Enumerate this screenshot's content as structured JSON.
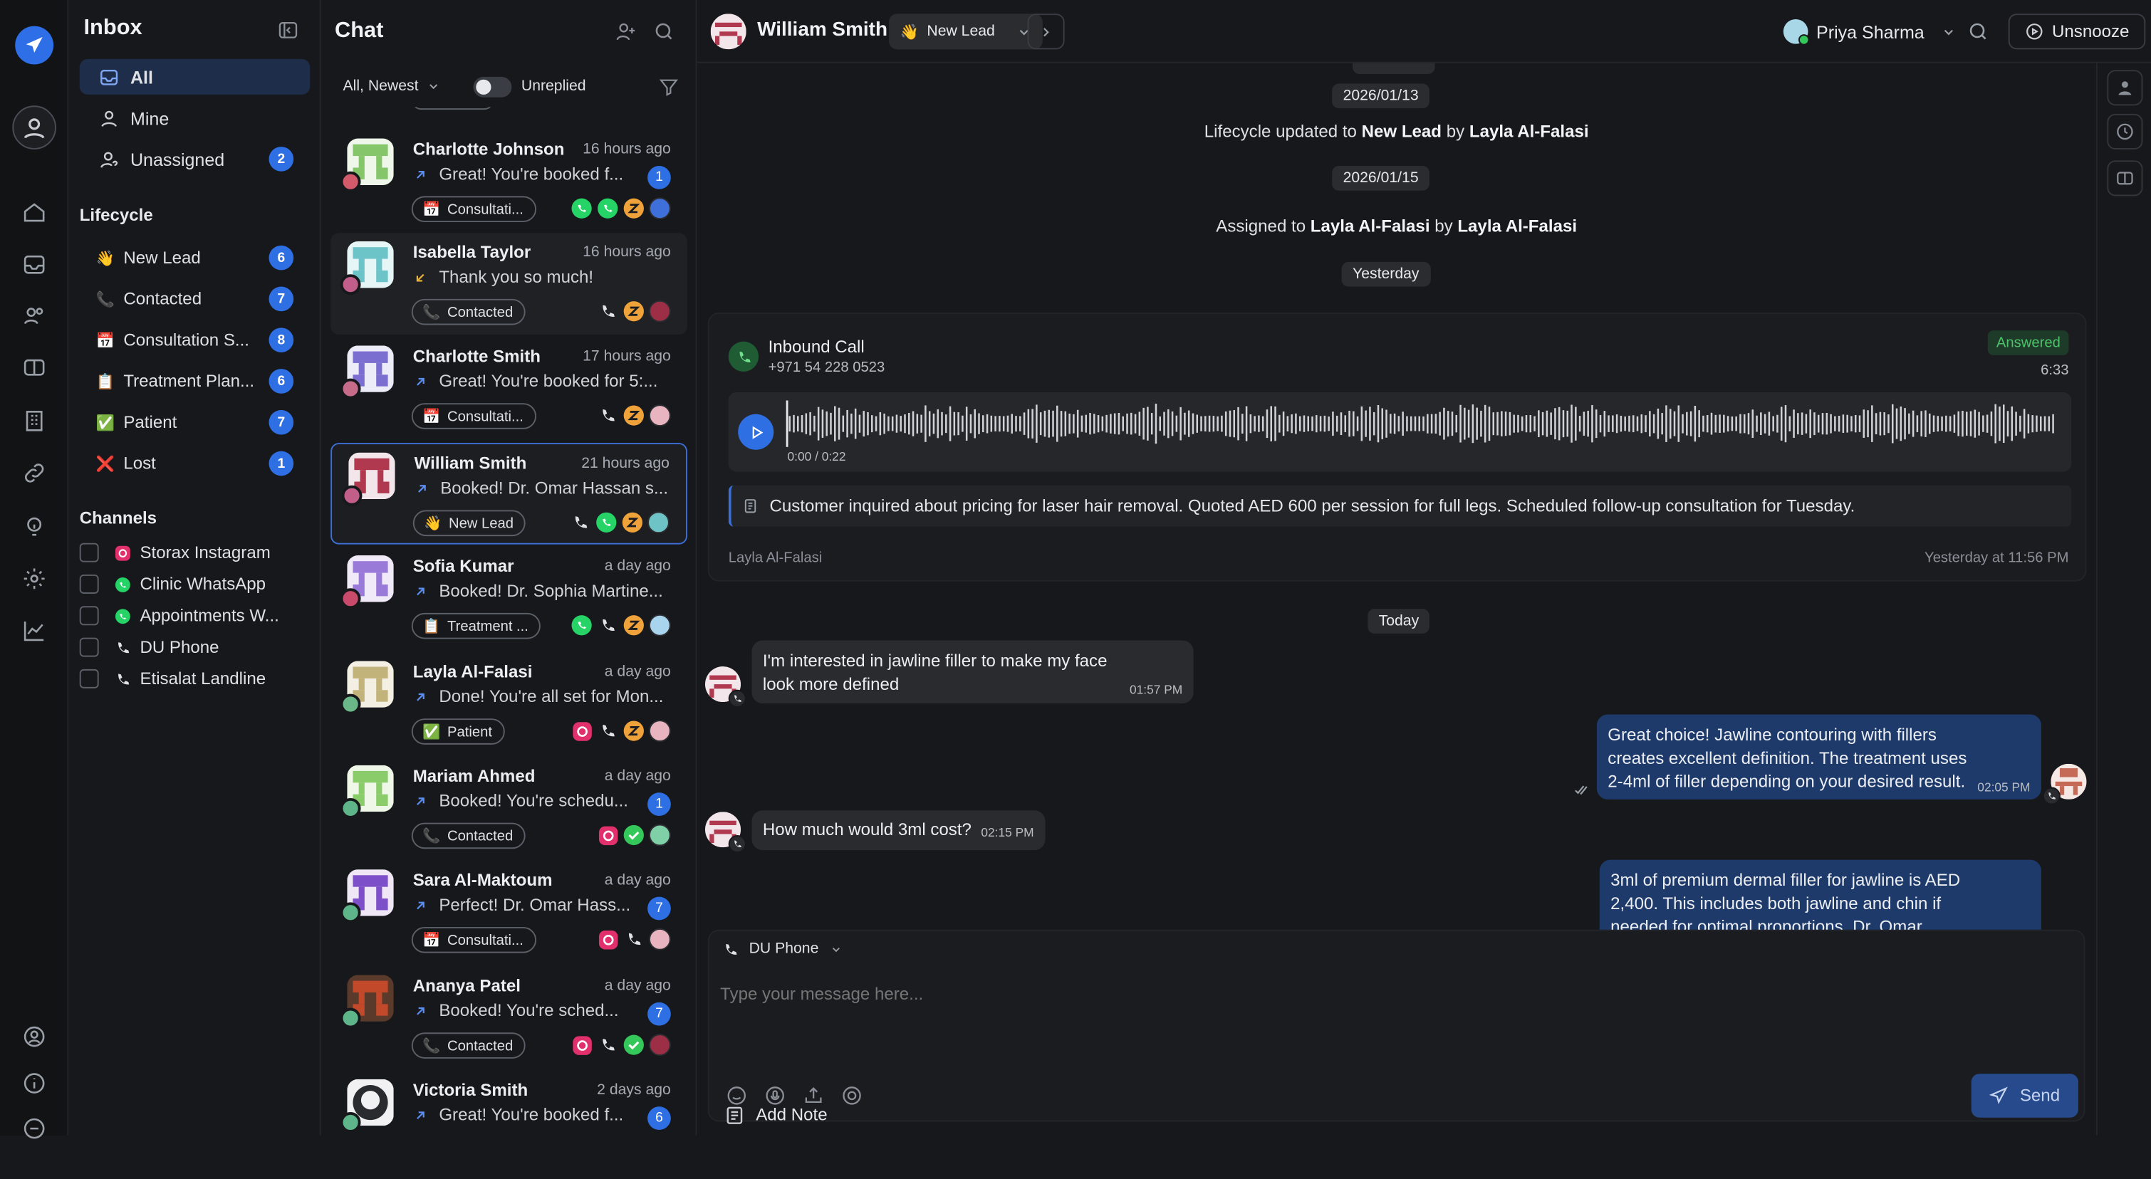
{
  "colors": {
    "accent": "#2f6fe4",
    "selected": "#3b6fd6",
    "outgoing_bubble": "#1e3a6b",
    "answered": "#4cc26a"
  },
  "rail": {
    "icons": [
      "send-logo-icon",
      "user-circle-icon",
      "home-icon",
      "inbox-icon",
      "contacts-icon",
      "tickets-icon",
      "building-icon",
      "link-icon",
      "bulb-icon",
      "settings-icon",
      "analytics-icon",
      "profile-icon",
      "info-icon",
      "minus-circle-icon"
    ]
  },
  "inbox": {
    "title": "Inbox",
    "nav": [
      {
        "label": "All",
        "badge": ""
      },
      {
        "label": "Mine",
        "badge": ""
      },
      {
        "label": "Unassigned",
        "badge": "2"
      }
    ],
    "lifecycle_title": "Lifecycle",
    "lifecycle": [
      {
        "emoji": "👋",
        "label": "New Lead",
        "count": "6"
      },
      {
        "emoji": "📞",
        "label": "Contacted",
        "count": "7"
      },
      {
        "emoji": "📅",
        "label": "Consultation S...",
        "count": "8"
      },
      {
        "emoji": "📋",
        "label": "Treatment Plan...",
        "count": "6"
      },
      {
        "emoji": "✅",
        "label": "Patient",
        "count": "7"
      },
      {
        "emoji": "❌",
        "label": "Lost",
        "count": "1"
      }
    ],
    "channels_title": "Channels",
    "channels": [
      {
        "icon": "instagram-icon",
        "label": "Storax Instagram"
      },
      {
        "icon": "whatsapp-icon",
        "label": "Clinic WhatsApp"
      },
      {
        "icon": "whatsapp-icon",
        "label": "Appointments W..."
      },
      {
        "icon": "phone-icon",
        "label": "DU Phone"
      },
      {
        "icon": "phone-icon",
        "label": "Etisalat Landline"
      }
    ]
  },
  "chat": {
    "title": "Chat",
    "sort": "All, Newest",
    "unreplied": "Unreplied",
    "cards": [
      {
        "name": "Charlotte Johnson",
        "time": "16 hours ago",
        "dir": "out",
        "preview": "Great! You're booked f...",
        "count": "1",
        "tag_emoji": "📅",
        "tag": "Consultati...",
        "chans": [
          "whatsapp",
          "whatsapp",
          "z",
          "avatar-blue"
        ]
      },
      {
        "name": "Isabella Taylor",
        "time": "16 hours ago",
        "dir": "in",
        "preview": "Thank you so much!",
        "count": "",
        "tag_emoji": "📞",
        "tag": "Contacted",
        "chans": [
          "phone",
          "z",
          "avatar-red"
        ]
      },
      {
        "name": "Charlotte Smith",
        "time": "17 hours ago",
        "dir": "out",
        "preview": "Great! You're booked for 5:...",
        "count": "",
        "tag_emoji": "📅",
        "tag": "Consultati...",
        "chans": [
          "phone",
          "z",
          "avatar-pink"
        ]
      },
      {
        "name": "William Smith",
        "time": "21 hours ago",
        "dir": "out",
        "preview": "Booked! Dr. Omar Hassan s...",
        "count": "",
        "tag_emoji": "👋",
        "tag": "New Lead",
        "chans": [
          "phone",
          "whatsapp",
          "z",
          "avatar-teal"
        ]
      },
      {
        "name": "Sofia Kumar",
        "time": "a day ago",
        "dir": "out",
        "preview": "Booked! Dr. Sophia Martine...",
        "count": "",
        "tag_emoji": "📋",
        "tag": "Treatment ...",
        "chans": [
          "whatsapp",
          "phone",
          "z",
          "avatar-lightblue"
        ]
      },
      {
        "name": "Layla Al-Falasi",
        "time": "a day ago",
        "dir": "out",
        "preview": "Done! You're all set for Mon...",
        "count": "",
        "tag_emoji": "✅",
        "tag": "Patient",
        "chans": [
          "instagram",
          "phone",
          "z",
          "avatar-pink"
        ]
      },
      {
        "name": "Mariam Ahmed",
        "time": "a day ago",
        "dir": "out",
        "preview": "Booked! You're schedu...",
        "count": "1",
        "tag_emoji": "📞",
        "tag": "Contacted",
        "chans": [
          "instagram",
          "check",
          "avatar-green"
        ]
      },
      {
        "name": "Sara Al-Maktoum",
        "time": "a day ago",
        "dir": "out",
        "preview": "Perfect! Dr. Omar Hass...",
        "count": "7",
        "tag_emoji": "📅",
        "tag": "Consultati...",
        "chans": [
          "instagram",
          "phone",
          "avatar-pink"
        ]
      },
      {
        "name": "Ananya Patel",
        "time": "a day ago",
        "dir": "out",
        "preview": "Booked! You're sched...",
        "count": "7",
        "tag_emoji": "📞",
        "tag": "Contacted",
        "chans": [
          "instagram",
          "phone",
          "check",
          "avatar-red"
        ]
      },
      {
        "name": "Victoria Smith",
        "time": "2 days ago",
        "dir": "out",
        "preview": "Great! You're booked f...",
        "count": "6",
        "tag_emoji": "📋",
        "tag": "Treatment ...",
        "chans": [
          "instagram",
          "phone",
          "z",
          "avatar-white"
        ]
      }
    ]
  },
  "conversation": {
    "contact_name": "William Smith",
    "stage_emoji": "👋",
    "stage": "New Lead",
    "agent": "Priya Sharma",
    "unsnooze": "Unsnooze",
    "date1": "2026/01/13",
    "event1": {
      "pre": "Lifecycle updated to ",
      "b1": "New Lead",
      "mid": " by ",
      "b2": "Layla Al-Falasi"
    },
    "date2": "2026/01/15",
    "event2": {
      "pre": "Assigned to ",
      "b1": "Layla Al-Falasi",
      "mid": " by ",
      "b2": "Layla Al-Falasi"
    },
    "date3": "Yesterday",
    "call": {
      "title": "Inbound Call",
      "number": "+971 54 228 0523",
      "status": "Answered",
      "duration": "6:33",
      "progress": "0:00 / 0:22",
      "played_fraction": 0,
      "note": "Customer inquired about pricing for laser hair removal. Quoted AED 600 per session for full legs. Scheduled follow-up consultation for Tuesday.",
      "by": "Layla Al-Falasi",
      "at": "Yesterday at 11:56 PM"
    },
    "date4": "Today",
    "messages": [
      {
        "dir": "in",
        "text1": "I'm interested in jawline filler to make my face",
        "text2": "look more defined",
        "time": "01:57 PM"
      },
      {
        "dir": "out",
        "text1": "Great choice! Jawline contouring with fillers",
        "text2": "creates excellent definition. The treatment uses",
        "text3": "2-4ml of filler depending on your desired result.",
        "time": "02:05 PM"
      },
      {
        "dir": "in",
        "text1": "How much would 3ml cost?",
        "time": "02:15 PM"
      },
      {
        "dir": "out",
        "text1": "3ml of premium dermal filler for jawline is AED",
        "text2": "2,400. This includes both jawline and chin if",
        "text3": "needed for optimal proportions. Dr. Omar"
      }
    ],
    "composer": {
      "channel": "DU Phone",
      "placeholder": "Type your message here...",
      "send": "Send",
      "add_note": "Add Note"
    }
  }
}
